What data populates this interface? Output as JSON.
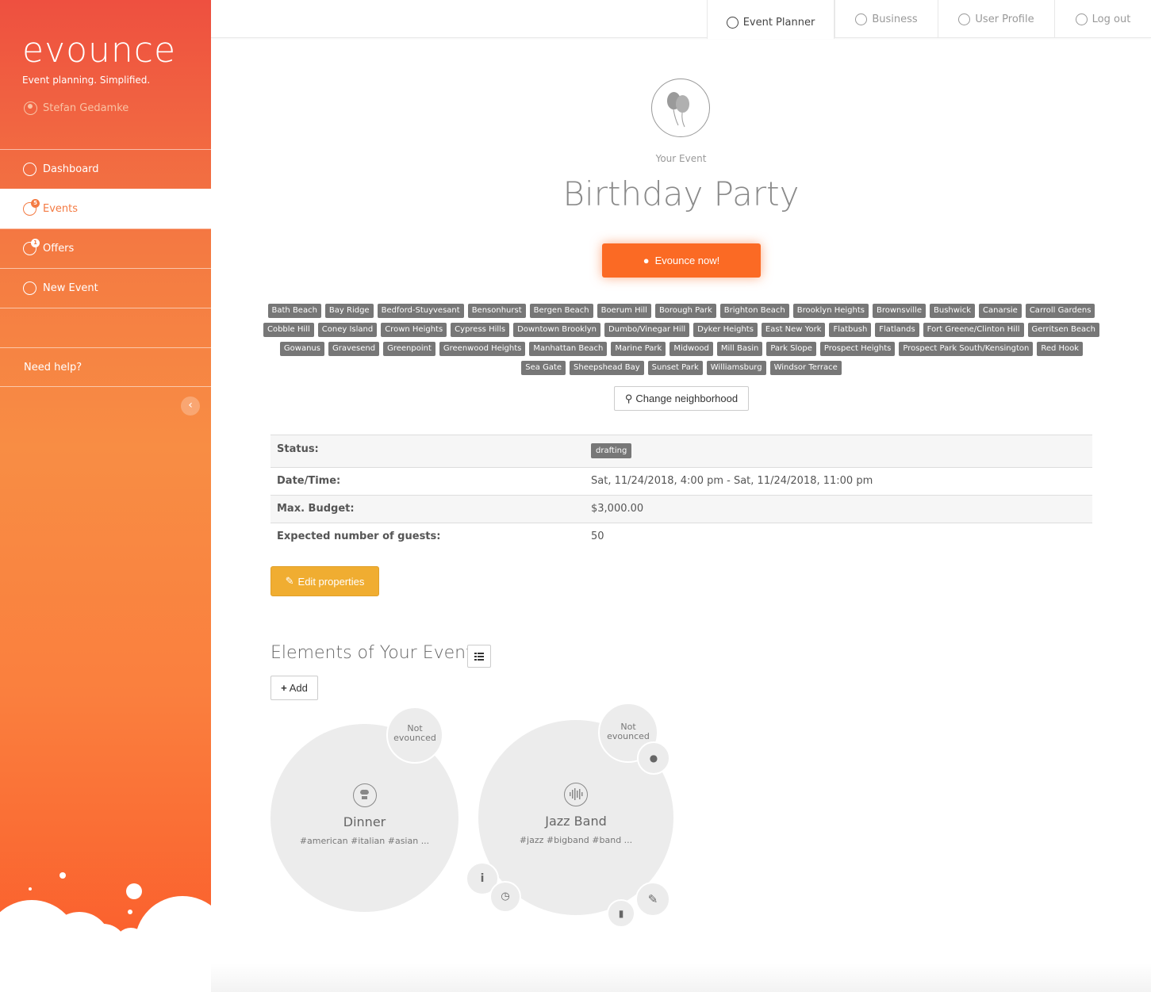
{
  "brand": {
    "logo_text": "evounce",
    "tagline": "Event planning. Simplified.",
    "user_name": "Stefan Gedamke"
  },
  "sidebar": {
    "items": [
      {
        "label": "Dashboard",
        "icon": "dashboard-icon"
      },
      {
        "label": "Events",
        "icon": "events-icon",
        "badge": "5"
      },
      {
        "label": "Offers",
        "icon": "offers-icon",
        "badge": "1"
      },
      {
        "label": "New Event",
        "icon": "plus-circle-icon"
      },
      {
        "label": ""
      },
      {
        "label": "Need help?"
      }
    ],
    "collapse_glyph": "‹"
  },
  "topbar": {
    "tabs": [
      {
        "label": "Event Planner",
        "icon": "event-planner-icon"
      },
      {
        "label": "Business",
        "icon": "chart-icon"
      },
      {
        "label": "User Profile",
        "icon": "user-icon"
      },
      {
        "label": "Log out",
        "icon": "logout-icon"
      }
    ]
  },
  "event": {
    "label": "Your Event",
    "title": "Birthday Party",
    "evounce_button": "Evounce now!",
    "neighborhoods": [
      "Bath Beach",
      "Bay Ridge",
      "Bedford-Stuyvesant",
      "Bensonhurst",
      "Bergen Beach",
      "Boerum Hill",
      "Borough Park",
      "Brighton Beach",
      "Brooklyn Heights",
      "Brownsville",
      "Bushwick",
      "Canarsie",
      "Carroll Gardens",
      "Cobble Hill",
      "Coney Island",
      "Crown Heights",
      "Cypress Hills",
      "Downtown Brooklyn",
      "Dumbo/Vinegar Hill",
      "Dyker Heights",
      "East New York",
      "Flatbush",
      "Flatlands",
      "Fort Greene/Clinton Hill",
      "Gerritsen Beach",
      "Gowanus",
      "Gravesend",
      "Greenpoint",
      "Greenwood Heights",
      "Manhattan Beach",
      "Marine Park",
      "Midwood",
      "Mill Basin",
      "Park Slope",
      "Prospect Heights",
      "Prospect Park South/Kensington",
      "Red Hook",
      "Sea Gate",
      "Sheepshead Bay",
      "Sunset Park",
      "Williamsburg",
      "Windsor Terrace"
    ],
    "change_neighborhood": "Change neighborhood",
    "properties": {
      "status_label": "Status:",
      "status_value": "drafting",
      "datetime_label": "Date/Time:",
      "datetime_value": "Sat, 11/24/2018, 4:00 pm - Sat, 11/24/2018, 11:00 pm",
      "budget_label": "Max. Budget:",
      "budget_value": "$3,000.00",
      "guests_label": "Expected number of guests:",
      "guests_value": "50"
    },
    "edit_button": "Edit properties"
  },
  "elements": {
    "title": "Elements of Your Event",
    "add_button": "Add",
    "items": [
      {
        "name": "Dinner",
        "tags": "#american #italian #asian ...",
        "status": "Not evounced",
        "icon": "chef-icon"
      },
      {
        "name": "Jazz Band",
        "tags": "#jazz #bigband #band ...",
        "status": "Not evounced",
        "icon": "audio-wave-icon"
      }
    ]
  },
  "colors": {
    "accent": "#fb6a24",
    "warning": "#f0ad31",
    "tag_bg": "#777777"
  }
}
